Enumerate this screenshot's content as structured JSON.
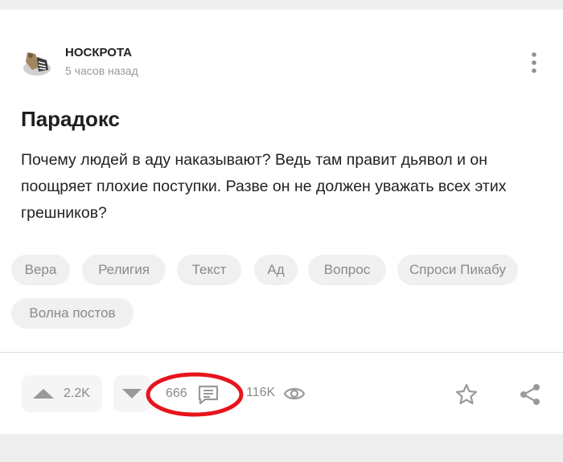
{
  "post": {
    "author": "НОСКРОТА",
    "time": "5 часов назад",
    "title": "Парадокс",
    "text": "Почему людей в аду наказывают? Ведь там правит дьявол и он поощряет плохие поступки. Разве он не должен уважать всех этих грешников?",
    "tags": [
      "Вера",
      "Религия",
      "Текст",
      "Ад",
      "Вопрос",
      "Спроси Пикабу",
      "Волна постов"
    ]
  },
  "footer": {
    "rating": "2.2K",
    "comments": "666",
    "views": "116K"
  },
  "icons": {
    "more": "more-vertical-icon",
    "upvote": "arrow-up-icon",
    "downvote": "arrow-down-icon",
    "comments": "comment-icon",
    "views": "eye-icon",
    "favorite": "star-icon",
    "share": "share-icon"
  },
  "colors": {
    "highlight": "#e8141c",
    "icon": "#999999",
    "tag_bg": "#f0f0f0"
  }
}
